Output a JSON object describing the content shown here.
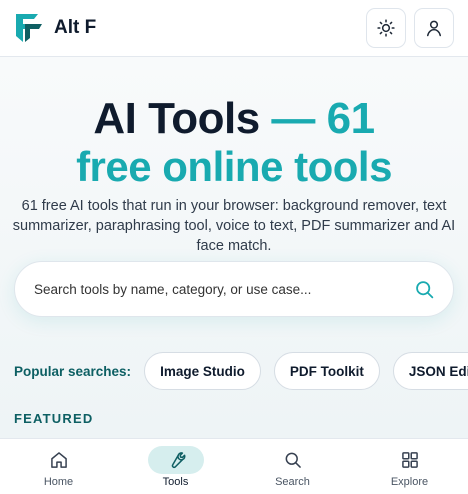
{
  "header": {
    "brand_name": "Alt F",
    "logo_icon": "altf-logo-icon",
    "theme_toggle_icon": "sun-icon",
    "account_icon": "user-icon"
  },
  "hero": {
    "title_line1_main": "AI Tools",
    "title_line1_accent": "— 61",
    "title_line2": "free online tools",
    "subtitle": "61 free AI tools that run in your browser: background remover, text summarizer, paraphrasing tool, voice to text, PDF summarizer and AI face match."
  },
  "search": {
    "placeholder": "Search tools by name, category, or use case...",
    "icon": "search-icon"
  },
  "popular": {
    "label": "Popular searches:",
    "chips": [
      "Image Studio",
      "PDF Toolkit",
      "JSON Edito"
    ]
  },
  "featured": {
    "label": "FEATURED"
  },
  "bottom_nav": {
    "items": [
      {
        "label": "Home",
        "icon": "home-icon",
        "active": false
      },
      {
        "label": "Tools",
        "icon": "wrench-icon",
        "active": true
      },
      {
        "label": "Search",
        "icon": "search-icon",
        "active": false
      },
      {
        "label": "Explore",
        "icon": "grid-icon",
        "active": false
      }
    ]
  },
  "colors": {
    "accent": "#19aab0",
    "dark_text": "#0f1b2d",
    "label_teal": "#0d5f63",
    "active_nav_bg": "#d6eeee"
  }
}
